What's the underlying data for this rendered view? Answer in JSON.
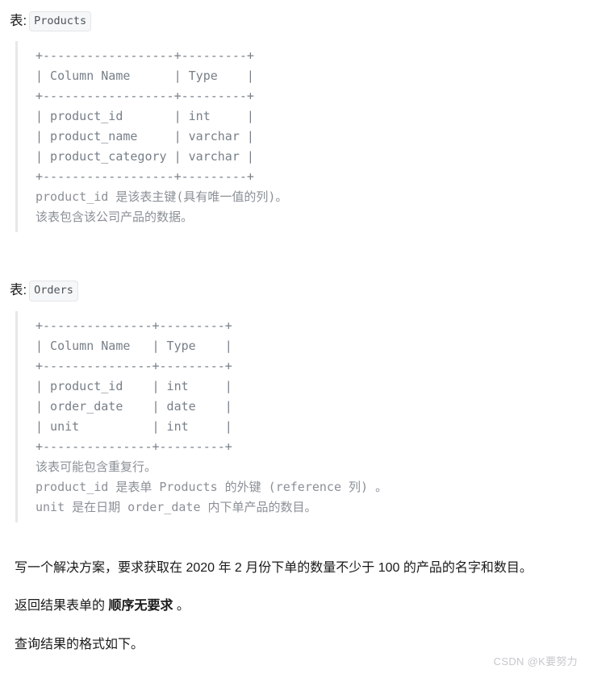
{
  "document": {
    "sections": [
      {
        "label_prefix": "表:",
        "table_name": "Products",
        "ascii_table": "+------------------+---------+\n| Column Name      | Type    |\n+------------------+---------+\n| product_id       | int     |\n| product_name     | varchar |\n| product_category | varchar |\n+------------------+---------+",
        "notes": [
          "product_id 是该表主键(具有唯一值的列)。",
          "该表包含该公司产品的数据。"
        ]
      },
      {
        "label_prefix": "表:",
        "table_name": "Orders",
        "ascii_table": "+---------------+---------+\n| Column Name   | Type    |\n+---------------+---------+\n| product_id    | int     |\n| order_date    | date    |\n| unit          | int     |\n+---------------+---------+",
        "notes": [
          "该表可能包含重复行。",
          "product_id 是表单 Products 的外键 (reference 列) 。",
          "unit 是在日期 order_date 内下单产品的数目。"
        ]
      }
    ],
    "paragraphs": [
      {
        "id": "task",
        "parts": [
          {
            "text": "写一个解决方案，要求获取在 2020 年 2 月份下单的数量不少于 100 的产品的名字和数目。",
            "bold": false
          }
        ]
      },
      {
        "id": "ordering",
        "parts": [
          {
            "text": "返回结果表单的 ",
            "bold": false
          },
          {
            "text": "顺序无要求",
            "bold": true
          },
          {
            "text": " 。",
            "bold": false
          }
        ]
      },
      {
        "id": "format",
        "parts": [
          {
            "text": "查询结果的格式如下。",
            "bold": false
          }
        ]
      }
    ],
    "paragraph_plain": {
      "task": "写一个解决方案，要求获取在 2020 年 2 月份下单的数量不少于 100 的产品的名字和数目。",
      "ordering_pre": "返回结果表单的 ",
      "ordering_bold": "顺序无要求",
      "ordering_post": " 。",
      "format": "查询结果的格式如下。"
    },
    "watermark": "CSDN @K要努力",
    "colors": {
      "text": "#1a1a1a",
      "code": "#777f88",
      "note": "#8b9097",
      "quote_border": "#e6e8ea",
      "chip_bg": "#f6f7f8",
      "watermark": "#c6c8cb"
    }
  }
}
